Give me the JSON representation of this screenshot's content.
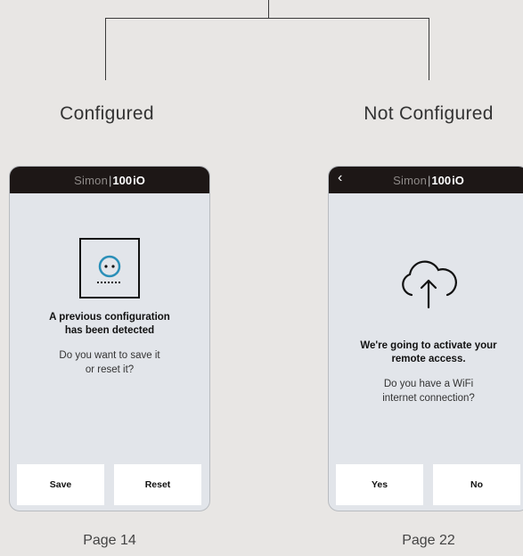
{
  "branches": [
    {
      "label": "Configured",
      "screen": {
        "brand": {
          "light": "Simon",
          "bold": "100",
          "suffix": "iO"
        },
        "has_back": false,
        "icon": "socket-icon",
        "message_bold": "A previous configuration\nhas been detected",
        "message_question": "Do you want to save it\nor reset it?",
        "buttons": [
          "Save",
          "Reset"
        ]
      },
      "page": "Page 14"
    },
    {
      "label": "Not Configured",
      "screen": {
        "brand": {
          "light": "Simon",
          "bold": "100",
          "suffix": "iO"
        },
        "has_back": true,
        "back_icon": "chevron-left-icon",
        "icon": "cloud-upload-icon",
        "message_bold": "We're going to activate your\nremote access.",
        "message_question": "Do you have a WiFi\ninternet connection?",
        "buttons": [
          "Yes",
          "No"
        ]
      },
      "page": "Page 22"
    }
  ],
  "colors": {
    "background": "#e8e6e4",
    "phone_header": "#1d1716",
    "phone_body": "#e2e5ea",
    "socket_accent": "#2a8fb8"
  }
}
